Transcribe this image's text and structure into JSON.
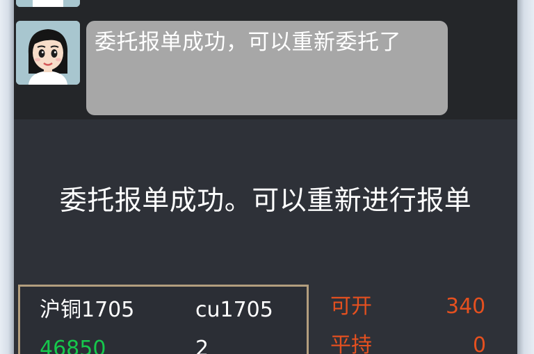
{
  "chat": {
    "messages": [
      {
        "text": ""
      },
      {
        "text": "委托报单成功，可以重新委托了"
      }
    ]
  },
  "notice": {
    "text": "委托报单成功。可以重新进行报单"
  },
  "contract": {
    "name": "沪铜1705",
    "code": "cu1705",
    "price": "46850",
    "qty": "2"
  },
  "side_panel": {
    "open_label": "可开",
    "open_value": "340",
    "close_label": "平持",
    "close_value": "0"
  },
  "colors": {
    "green": "#16c84c",
    "orange": "#e5501f",
    "bubble": "#a7a7a7",
    "background": "#2e3138"
  }
}
